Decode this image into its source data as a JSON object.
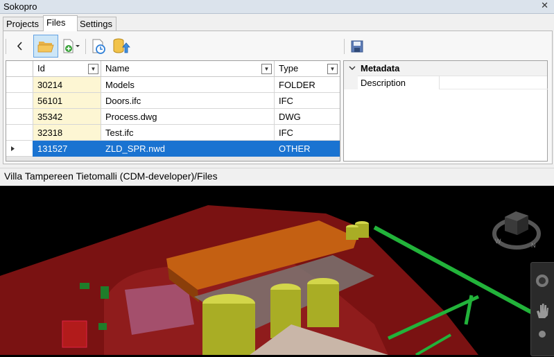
{
  "window": {
    "title": "Sokopro"
  },
  "tabs": [
    {
      "label": "Projects"
    },
    {
      "label": "Files"
    },
    {
      "label": "Settings"
    }
  ],
  "toolbar": {
    "back_icon": "chevron-left-icon",
    "open_icon": "folder-open-icon",
    "add_icon": "add-file-icon",
    "history_icon": "history-icon",
    "upload_icon": "database-upload-icon",
    "save_icon": "save-icon"
  },
  "table": {
    "columns": [
      "Id",
      "Name",
      "Type"
    ],
    "rows": [
      {
        "id": "30214",
        "name": "Models",
        "type": "FOLDER"
      },
      {
        "id": "56101",
        "name": "Doors.ifc",
        "type": "IFC"
      },
      {
        "id": "35342",
        "name": "Process.dwg",
        "type": "DWG"
      },
      {
        "id": "32318",
        "name": "Test.ifc",
        "type": "IFC"
      },
      {
        "id": "131527",
        "name": "ZLD_SPR.nwd",
        "type": "OTHER"
      }
    ],
    "selected_row": 4
  },
  "properties": {
    "category": "Metadata",
    "fields": [
      {
        "label": "Description",
        "value": ""
      }
    ]
  },
  "status": {
    "path": "Villa Tampereen Tietomalli (CDM-developer)/Files"
  },
  "colors": {
    "selection": "#1a73d1",
    "id_highlight": "#fdf6d3",
    "accent": "#62a2e4"
  }
}
